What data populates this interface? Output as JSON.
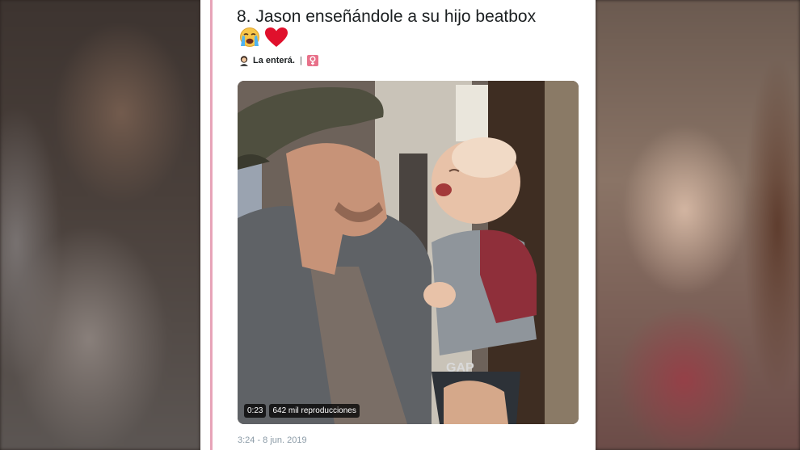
{
  "tweet": {
    "text": "8. Jason enseñándole a su hijo beatbox",
    "emojis": [
      "crying-face",
      "red-heart"
    ],
    "author_name": "La enterá.",
    "author_separator": "|",
    "author_icon": "woman-icon",
    "author_badge_icon": "female-sign-icon",
    "timestamp": "3:24 - 8 jun. 2019"
  },
  "video": {
    "duration": "0:23",
    "views": "642 mil reproducciones"
  },
  "colors": {
    "card_accent_line": "#e7a4b8",
    "text": "#1c2022",
    "timestamp": "#8a9aa6",
    "badge": "#e8718a"
  }
}
